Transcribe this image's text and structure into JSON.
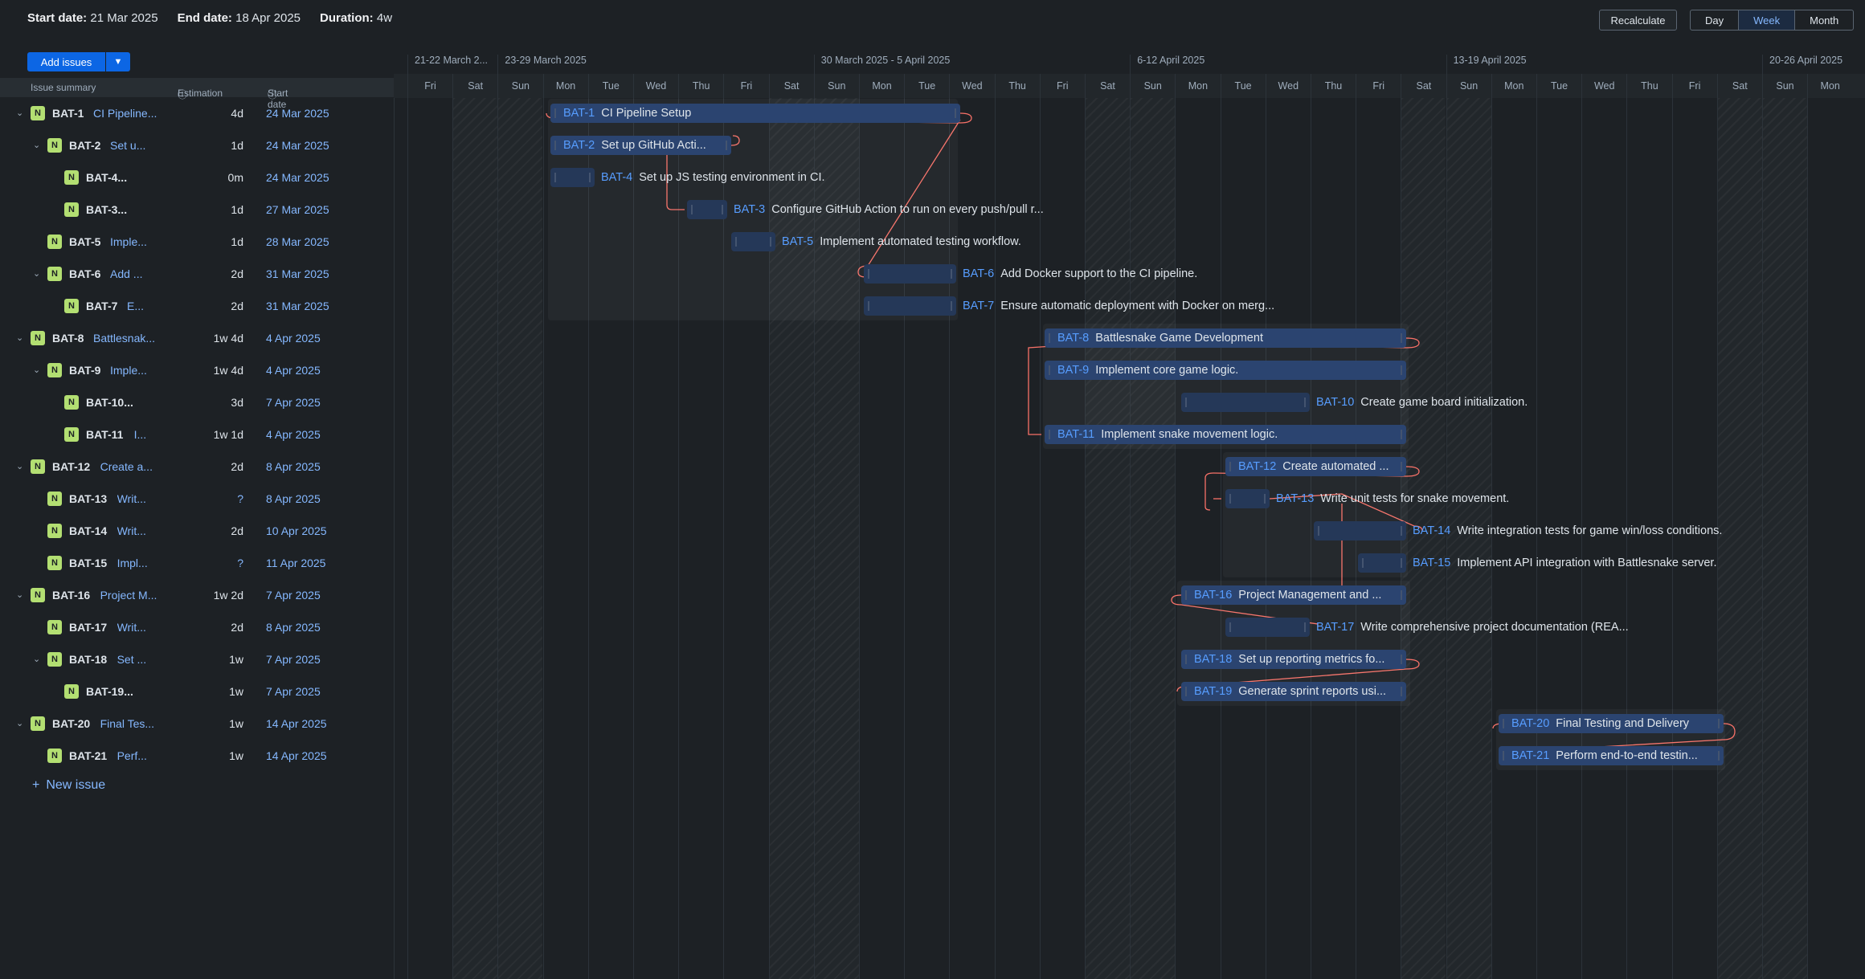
{
  "header": {
    "start_label": "Start date:",
    "start_value": "21 Mar 2025",
    "end_label": "End date:",
    "end_value": "18 Apr 2025",
    "duration_label": "Duration:",
    "duration_value": "4w",
    "recalculate": "Recalculate",
    "views": [
      "Day",
      "Week",
      "Month"
    ],
    "active_view": "Week"
  },
  "toolbar": {
    "add_issues": "Add issues"
  },
  "columns": {
    "summary": "Issue summary",
    "estimation": "Estimation",
    "start": "Start date"
  },
  "issues": [
    {
      "key": "BAT-1",
      "title": "CI Pipeline...",
      "est": "4d",
      "date": "24 Mar 2025",
      "level": 0,
      "expandable": true
    },
    {
      "key": "BAT-2",
      "title": "Set u...",
      "est": "1d",
      "date": "24 Mar 2025",
      "level": 1,
      "expandable": true
    },
    {
      "key": "BAT-4...",
      "title": "",
      "est": "0m",
      "date": "24 Mar 2025",
      "level": 2,
      "expandable": false
    },
    {
      "key": "BAT-3...",
      "title": "",
      "est": "1d",
      "date": "27 Mar 2025",
      "level": 2,
      "expandable": false
    },
    {
      "key": "BAT-5",
      "title": "Imple...",
      "est": "1d",
      "date": "28 Mar 2025",
      "level": 1,
      "expandable": false
    },
    {
      "key": "BAT-6",
      "title": "Add ...",
      "est": "2d",
      "date": "31 Mar 2025",
      "level": 1,
      "expandable": true
    },
    {
      "key": "BAT-7",
      "title": "E...",
      "est": "2d",
      "date": "31 Mar 2025",
      "level": 2,
      "expandable": false
    },
    {
      "key": "BAT-8",
      "title": "Battlesnak...",
      "est": "1w 4d",
      "date": "4 Apr 2025",
      "level": 0,
      "expandable": true
    },
    {
      "key": "BAT-9",
      "title": "Imple...",
      "est": "1w 4d",
      "date": "4 Apr 2025",
      "level": 1,
      "expandable": true
    },
    {
      "key": "BAT-10...",
      "title": "",
      "est": "3d",
      "date": "7 Apr 2025",
      "level": 2,
      "expandable": false
    },
    {
      "key": "BAT-11",
      "title": "I...",
      "est": "1w 1d",
      "date": "4 Apr 2025",
      "level": 2,
      "expandable": false
    },
    {
      "key": "BAT-12",
      "title": "Create a...",
      "est": "2d",
      "date": "8 Apr 2025",
      "level": 0,
      "expandable": true
    },
    {
      "key": "BAT-13",
      "title": "Writ...",
      "est": "?",
      "date": "8 Apr 2025",
      "level": 1,
      "expandable": false
    },
    {
      "key": "BAT-14",
      "title": "Writ...",
      "est": "2d",
      "date": "10 Apr 2025",
      "level": 1,
      "expandable": false
    },
    {
      "key": "BAT-15",
      "title": "Impl...",
      "est": "?",
      "date": "11 Apr 2025",
      "level": 1,
      "expandable": false
    },
    {
      "key": "BAT-16",
      "title": "Project M...",
      "est": "1w 2d",
      "date": "7 Apr 2025",
      "level": 0,
      "expandable": true
    },
    {
      "key": "BAT-17",
      "title": "Writ...",
      "est": "2d",
      "date": "8 Apr 2025",
      "level": 1,
      "expandable": false
    },
    {
      "key": "BAT-18",
      "title": "Set ...",
      "est": "1w",
      "date": "7 Apr 2025",
      "level": 1,
      "expandable": true
    },
    {
      "key": "BAT-19...",
      "title": "",
      "est": "1w",
      "date": "7 Apr 2025",
      "level": 2,
      "expandable": false
    },
    {
      "key": "BAT-20",
      "title": "Final Tes...",
      "est": "1w",
      "date": "14 Apr 2025",
      "level": 0,
      "expandable": true
    },
    {
      "key": "BAT-21",
      "title": "Perf...",
      "est": "1w",
      "date": "14 Apr 2025",
      "level": 1,
      "expandable": false
    }
  ],
  "new_issue": "New issue",
  "timeline": {
    "weeks": [
      "21-22 March 2...",
      "23-29 March 2025",
      "30 March 2025 - 5 April 2025",
      "6-12 April 2025",
      "13-19 April 2025",
      "20-26 April 2025"
    ],
    "days": [
      "Fri",
      "Sat",
      "Sun",
      "Mon",
      "Tue",
      "Wed",
      "Thu",
      "Fri",
      "Sat",
      "Sun",
      "Mon",
      "Tue",
      "Wed",
      "Thu",
      "Fri",
      "Sat",
      "Sun",
      "Mon",
      "Tue",
      "Wed",
      "Thu",
      "Fri",
      "Sat",
      "Sun",
      "Mon",
      "Tue",
      "Wed",
      "Thu",
      "Fri",
      "Sat",
      "Sun",
      "Mon"
    ]
  },
  "bars": [
    {
      "key": "BAT-1",
      "label": "CI Pipeline Setup",
      "inside": true,
      "start": "24 Mar 2025",
      "days": 4
    },
    {
      "key": "BAT-2",
      "label": "Set up GitHub Acti...",
      "inside": true,
      "start": "24 Mar 2025",
      "days": 1
    },
    {
      "key": "BAT-4",
      "label": "Set up JS testing environment in CI.",
      "inside": false,
      "start": "24 Mar 2025",
      "days": 0
    },
    {
      "key": "BAT-3",
      "label": "Configure GitHub Action to run on every push/pull r...",
      "inside": false,
      "start": "27 Mar 2025",
      "days": 1
    },
    {
      "key": "BAT-5",
      "label": "Implement automated testing workflow.",
      "inside": false,
      "start": "28 Mar 2025",
      "days": 1
    },
    {
      "key": "BAT-6",
      "label": "Add Docker support to the CI pipeline.",
      "inside": false,
      "start": "31 Mar 2025",
      "days": 2
    },
    {
      "key": "BAT-7",
      "label": "Ensure automatic deployment with Docker on merg...",
      "inside": false,
      "start": "31 Mar 2025",
      "days": 2
    },
    {
      "key": "BAT-8",
      "label": "Battlesnake Game Development",
      "inside": true,
      "start": "4 Apr 2025",
      "days": 9
    },
    {
      "key": "BAT-9",
      "label": "Implement core game logic.",
      "inside": true,
      "start": "4 Apr 2025",
      "days": 9
    },
    {
      "key": "BAT-10",
      "label": "Create game board initialization.",
      "inside": false,
      "start": "7 Apr 2025",
      "days": 3
    },
    {
      "key": "BAT-11",
      "label": "Implement snake movement logic.",
      "inside": true,
      "start": "4 Apr 2025",
      "days": 6
    },
    {
      "key": "BAT-12",
      "label": "Create automated ...",
      "inside": true,
      "start": "8 Apr 2025",
      "days": 2
    },
    {
      "key": "BAT-13",
      "label": "Write unit tests for snake movement.",
      "inside": false,
      "start": "8 Apr 2025",
      "days": null
    },
    {
      "key": "BAT-14",
      "label": "Write integration tests for game win/loss conditions.",
      "inside": false,
      "start": "10 Apr 2025",
      "days": 2
    },
    {
      "key": "BAT-15",
      "label": "Implement API integration with Battlesnake server.",
      "inside": false,
      "start": "11 Apr 2025",
      "days": null
    },
    {
      "key": "BAT-16",
      "label": "Project Management and ...",
      "inside": true,
      "start": "7 Apr 2025",
      "days": 7
    },
    {
      "key": "BAT-17",
      "label": "Write comprehensive project documentation (REA...",
      "inside": false,
      "start": "8 Apr 2025",
      "days": 2
    },
    {
      "key": "BAT-18",
      "label": "Set up reporting metrics fo...",
      "inside": true,
      "start": "7 Apr 2025",
      "days": 5
    },
    {
      "key": "BAT-19",
      "label": "Generate sprint reports usi...",
      "inside": true,
      "start": "7 Apr 2025",
      "days": 5
    },
    {
      "key": "BAT-20",
      "label": "Final Testing and Delivery",
      "inside": true,
      "start": "14 Apr 2025",
      "days": 5
    },
    {
      "key": "BAT-21",
      "label": "Perform end-to-end testin...",
      "inside": true,
      "start": "14 Apr 2025",
      "days": 5
    }
  ],
  "colors": {
    "accent": "#0c66e4",
    "bar": "#253858",
    "link": "#f87168",
    "badge": "#b3df72",
    "key": "#579dff"
  }
}
